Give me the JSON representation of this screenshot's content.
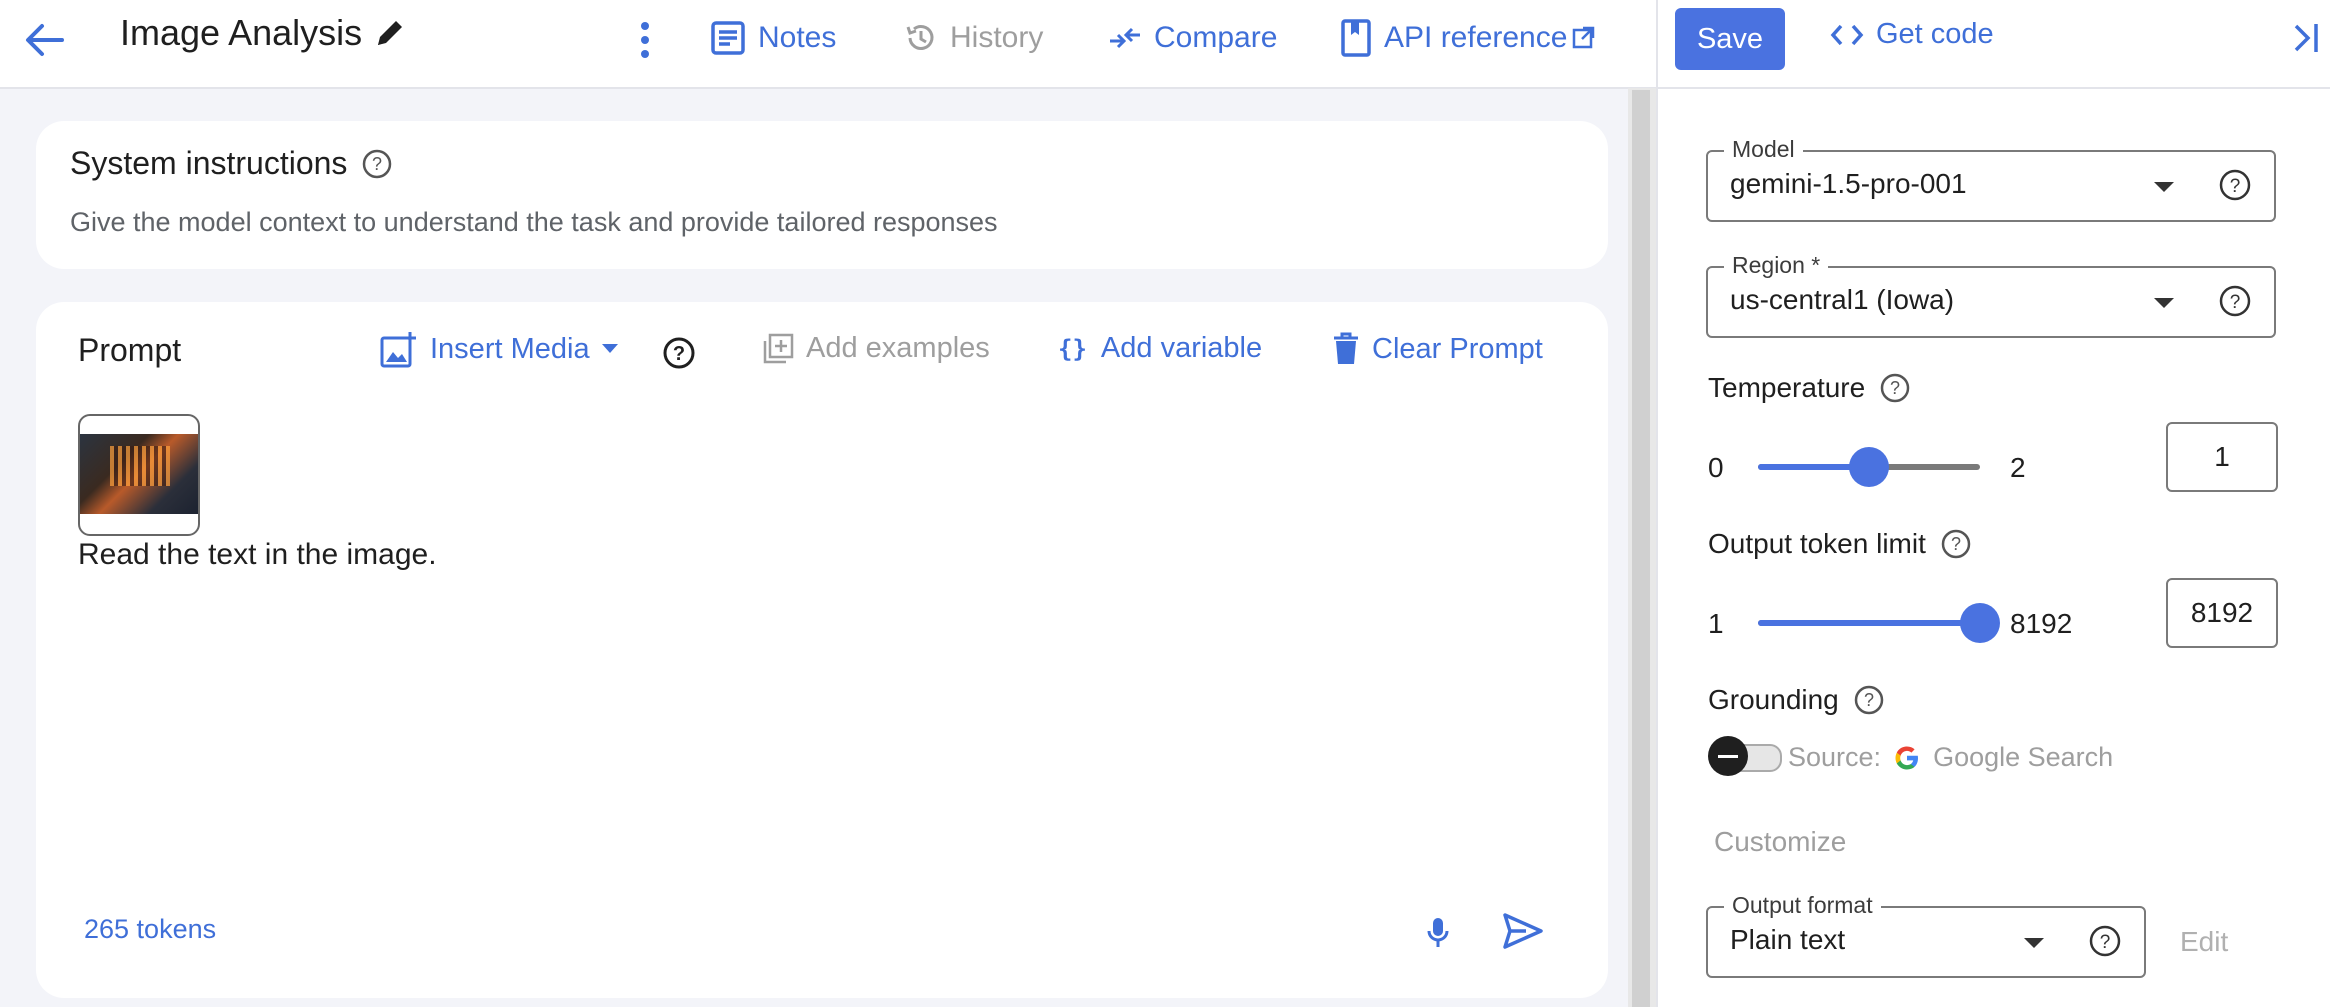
{
  "header": {
    "title": "Image Analysis",
    "notes_label": "Notes",
    "history_label": "History",
    "compare_label": "Compare",
    "api_label": "API reference",
    "save_label": "Save",
    "get_code_label": "Get code"
  },
  "system": {
    "title": "System instructions",
    "placeholder": "Give the model context to understand the task and provide tailored responses"
  },
  "prompt": {
    "title": "Prompt",
    "insert_media_label": "Insert Media",
    "add_examples_label": "Add examples",
    "add_variable_label": "Add variable",
    "clear_prompt_label": "Clear Prompt",
    "text": "Read the text in the image.",
    "tokens": "265 tokens"
  },
  "settings": {
    "model": {
      "label": "Model",
      "value": "gemini-1.5-pro-001"
    },
    "region": {
      "label": "Region *",
      "value": "us-central1 (Iowa)"
    },
    "temperature": {
      "label": "Temperature",
      "min": "0",
      "max": "2",
      "value": "1",
      "fraction": 0.5
    },
    "output_tokens": {
      "label": "Output token limit",
      "min": "1",
      "max": "8192",
      "value": "8192",
      "fraction": 1.0
    },
    "grounding": {
      "label": "Grounding",
      "source_label": "Source:",
      "source_value": "Google Search",
      "enabled": false
    },
    "customize_label": "Customize",
    "output_format": {
      "label": "Output format",
      "value": "Plain text",
      "edit_label": "Edit"
    }
  },
  "colors": {
    "accent": "#4a72e0",
    "link": "#3f6fd8",
    "muted": "#9e9e9e"
  }
}
